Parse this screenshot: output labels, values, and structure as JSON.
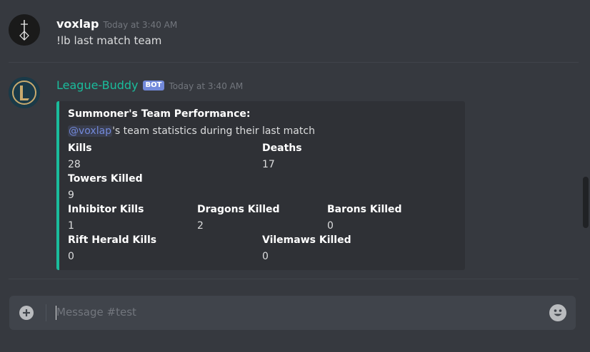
{
  "messages": [
    {
      "author": "voxlap",
      "timestamp": "Today at 3:40 AM",
      "text": "!lb last match team"
    },
    {
      "author": "League-Buddy",
      "badge": "BOT",
      "timestamp": "Today at 3:40 AM",
      "embed": {
        "title": "Summoner's Team Performance:",
        "mention": "@voxlap",
        "desc_rest": "'s team statistics during their last match",
        "fields": [
          {
            "name": "Kills",
            "value": "28"
          },
          {
            "name": "Deaths",
            "value": "17"
          },
          {
            "name": "Towers Killed",
            "value": "9"
          },
          {
            "name": "Inhibitor Kills",
            "value": "1"
          },
          {
            "name": "Dragons Killed",
            "value": "2"
          },
          {
            "name": "Barons Killed",
            "value": "0"
          },
          {
            "name": "Rift Herald Kills",
            "value": "0"
          },
          {
            "name": "Vilemaws Killed",
            "value": "0"
          }
        ]
      }
    }
  ],
  "composer": {
    "placeholder": "Message #test"
  },
  "colors": {
    "background": "#36393f",
    "bot_name": "#1abc9c",
    "embed_accent": "#1abc9c",
    "mention": "#7289da"
  },
  "icons": {
    "user_avatar": "avatar-voxlap",
    "bot_avatar": "avatar-league-buddy",
    "add": "plus-circle-icon",
    "emoji": "smiley-icon"
  }
}
